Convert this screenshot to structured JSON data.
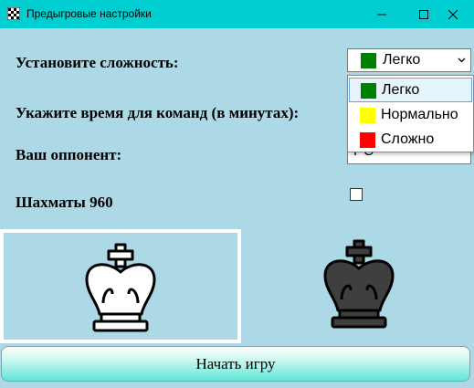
{
  "window": {
    "title": "Предыгровые настройки",
    "icon": "chessboard-icon",
    "controls": [
      "minimize-icon",
      "maximize-icon",
      "close-icon"
    ]
  },
  "settings": {
    "difficulty_label": "Установите сложность:",
    "time_label": "Укажите время для команд (в минутах):",
    "opponent_label": "Ваш оппонент:",
    "chess960_label": "Шахматы 960",
    "chess960_checked": false,
    "opponent_value_partial": "PC"
  },
  "difficulty": {
    "selected": "Легко",
    "selected_color": "#008000",
    "options": [
      {
        "label": "Легко",
        "color": "#008000"
      },
      {
        "label": "Нормально",
        "color": "#ffff00"
      },
      {
        "label": "Сложно",
        "color": "#ff0000"
      }
    ]
  },
  "pieces": {
    "white": "white-king-icon",
    "black": "black-king-icon",
    "selected": "white"
  },
  "start_button": "Начать игру",
  "colors": {
    "titlebar": "#00ced1",
    "background": "#add8e6",
    "selection_border": "#ffffff"
  }
}
